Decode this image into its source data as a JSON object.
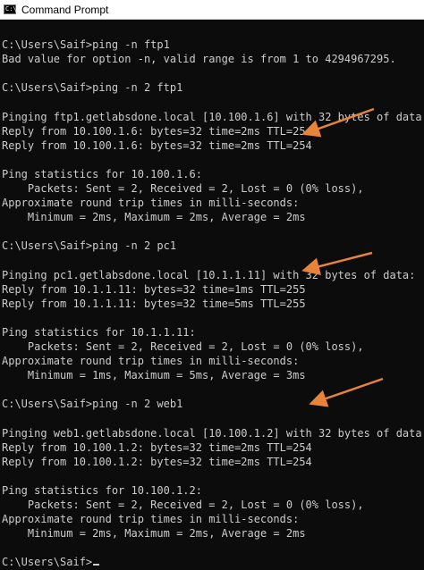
{
  "window": {
    "title": "Command Prompt",
    "icon": "command-prompt-icon"
  },
  "console": {
    "lines": [
      "",
      "C:\\Users\\Saif>ping -n ftp1",
      "Bad value for option -n, valid range is from 1 to 4294967295.",
      "",
      "C:\\Users\\Saif>ping -n 2 ftp1",
      "",
      "Pinging ftp1.getlabsdone.local [10.100.1.6] with 32 bytes of data:",
      "Reply from 10.100.1.6: bytes=32 time=2ms TTL=254",
      "Reply from 10.100.1.6: bytes=32 time=2ms TTL=254",
      "",
      "Ping statistics for 10.100.1.6:",
      "    Packets: Sent = 2, Received = 2, Lost = 0 (0% loss),",
      "Approximate round trip times in milli-seconds:",
      "    Minimum = 2ms, Maximum = 2ms, Average = 2ms",
      "",
      "C:\\Users\\Saif>ping -n 2 pc1",
      "",
      "Pinging pc1.getlabsdone.local [10.1.1.11] with 32 bytes of data:",
      "Reply from 10.1.1.11: bytes=32 time=1ms TTL=255",
      "Reply from 10.1.1.11: bytes=32 time=5ms TTL=255",
      "",
      "Ping statistics for 10.1.1.11:",
      "    Packets: Sent = 2, Received = 2, Lost = 0 (0% loss),",
      "Approximate round trip times in milli-seconds:",
      "    Minimum = 1ms, Maximum = 5ms, Average = 3ms",
      "",
      "C:\\Users\\Saif>ping -n 2 web1",
      "",
      "Pinging web1.getlabsdone.local [10.100.1.2] with 32 bytes of data:",
      "Reply from 10.100.1.2: bytes=32 time=2ms TTL=254",
      "Reply from 10.100.1.2: bytes=32 time=2ms TTL=254",
      "",
      "Ping statistics for 10.100.1.2:",
      "    Packets: Sent = 2, Received = 2, Lost = 0 (0% loss),",
      "Approximate round trip times in milli-seconds:",
      "    Minimum = 2ms, Maximum = 2ms, Average = 2ms",
      "",
      "C:\\Users\\Saif>"
    ],
    "text_color": "#cccccc",
    "background": "#0c0c0c"
  },
  "annotations": {
    "arrow_color": "#e8843a",
    "arrow_icon": "annotation-arrow-icon"
  }
}
